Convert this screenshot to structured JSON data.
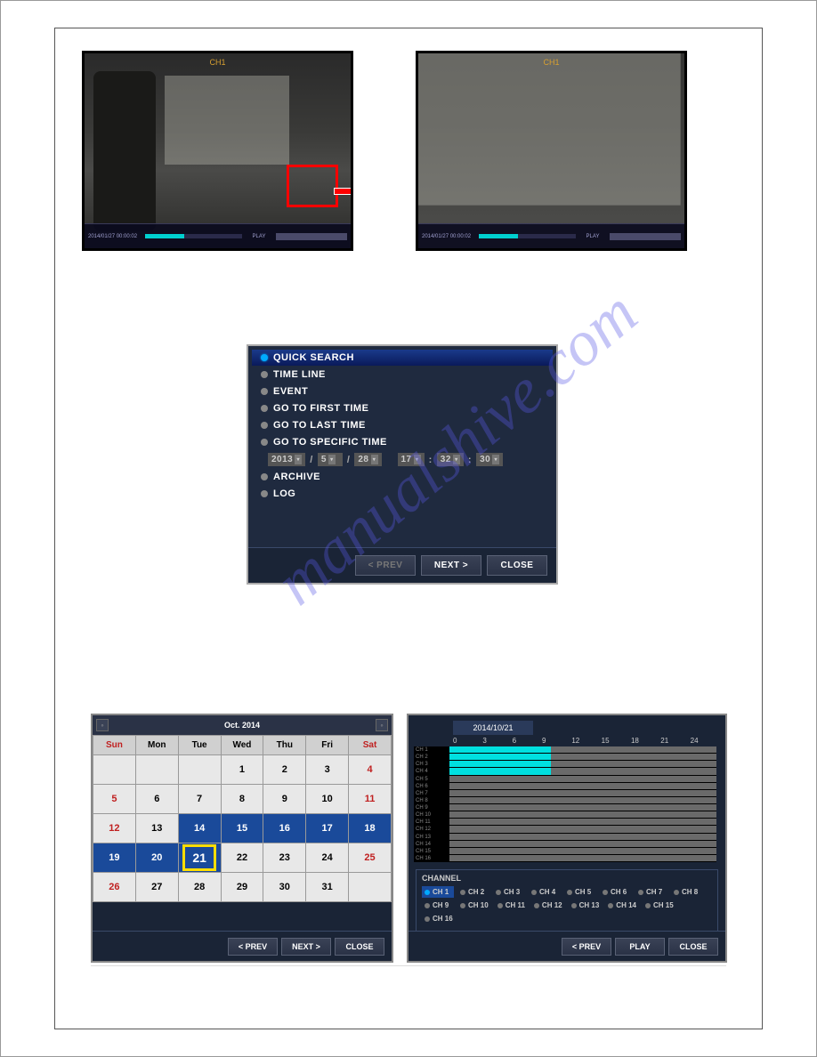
{
  "watermark": "manualshive.com",
  "cam": {
    "ch": "CH1",
    "ts": "2014/01/27  00:00:02",
    "mode": "PLAY"
  },
  "search_menu": {
    "items": [
      "QUICK SEARCH",
      "TIME LINE",
      "EVENT",
      "GO TO FIRST TIME",
      "GO TO LAST TIME",
      "GO TO SPECIFIC TIME"
    ],
    "after": [
      "ARCHIVE",
      "LOG"
    ],
    "date": {
      "y": "2013",
      "m": "5",
      "d": "28",
      "hh": "17",
      "mm": "32",
      "ss": "30"
    },
    "buttons": {
      "prev": "< PREV",
      "next": "NEXT >",
      "close": "CLOSE"
    }
  },
  "calendar": {
    "title": "Oct. 2014",
    "dow": [
      "Sun",
      "Mon",
      "Tue",
      "Wed",
      "Thu",
      "Fri",
      "Sat"
    ],
    "weeks": [
      [
        {
          "n": ""
        },
        {
          "n": ""
        },
        {
          "n": ""
        },
        {
          "n": "1"
        },
        {
          "n": "2"
        },
        {
          "n": "3"
        },
        {
          "n": "4",
          "sat": true
        }
      ],
      [
        {
          "n": "5",
          "sun": true
        },
        {
          "n": "6"
        },
        {
          "n": "7"
        },
        {
          "n": "8"
        },
        {
          "n": "9"
        },
        {
          "n": "10"
        },
        {
          "n": "11",
          "sat": true
        }
      ],
      [
        {
          "n": "12",
          "sun": true
        },
        {
          "n": "13"
        },
        {
          "n": "14",
          "rec": true
        },
        {
          "n": "15",
          "rec": true
        },
        {
          "n": "16",
          "rec": true
        },
        {
          "n": "17",
          "rec": true
        },
        {
          "n": "18",
          "rec": true,
          "sat": true
        }
      ],
      [
        {
          "n": "19",
          "rec": true,
          "sun": true
        },
        {
          "n": "20",
          "rec": true
        },
        {
          "n": "21",
          "sel": true
        },
        {
          "n": "22"
        },
        {
          "n": "23"
        },
        {
          "n": "24"
        },
        {
          "n": "25",
          "sat": true
        }
      ],
      [
        {
          "n": "26",
          "sun": true
        },
        {
          "n": "27"
        },
        {
          "n": "28"
        },
        {
          "n": "29"
        },
        {
          "n": "30"
        },
        {
          "n": "31"
        },
        {
          "n": ""
        }
      ]
    ],
    "buttons": {
      "prev": "< PREV",
      "next": "NEXT >",
      "close": "CLOSE"
    }
  },
  "timeline": {
    "date": "2014/10/21",
    "hours": [
      "0",
      "3",
      "6",
      "9",
      "12",
      "15",
      "18",
      "21",
      "24"
    ],
    "channels": [
      "CH 1",
      "CH 2",
      "CH 3",
      "CH 4",
      "CH 5",
      "CH 6",
      "CH 7",
      "CH 8",
      "CH 9",
      "CH 10",
      "CH 11",
      "CH 12",
      "CH 13",
      "CH 14",
      "CH 15",
      "CH 16"
    ],
    "fills": [
      38,
      38,
      38,
      38,
      0,
      0,
      0,
      0,
      0,
      0,
      0,
      0,
      0,
      0,
      0,
      0
    ],
    "ch_label": "CHANNEL",
    "ch_buttons": [
      "CH 1",
      "CH 2",
      "CH 3",
      "CH 4",
      "CH 5",
      "CH 6",
      "CH 7",
      "CH 8",
      "CH 9",
      "CH 10",
      "CH 11",
      "CH 12",
      "CH 13",
      "CH 14",
      "CH 15",
      "CH 16"
    ],
    "buttons": {
      "prev": "< PREV",
      "play": "PLAY",
      "close": "CLOSE"
    }
  }
}
